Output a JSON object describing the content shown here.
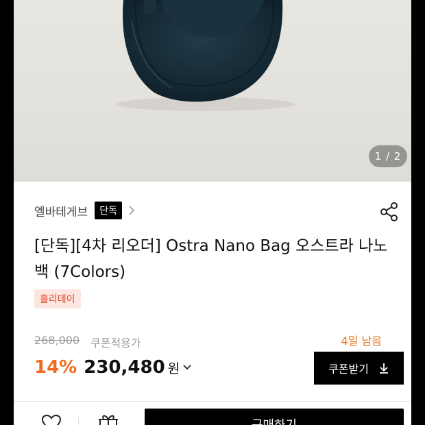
{
  "hero": {
    "pager": "1 / 2"
  },
  "brand": {
    "name": "엘바테게브",
    "badge": "단독"
  },
  "product": {
    "title": "[단독][4차 리오더] Ostra Nano Bag 오스트라 나노 백 (7Colors)",
    "tag": "홀리데이"
  },
  "pricing": {
    "original": "268,000",
    "coupon_note": "쿠폰적용가",
    "days_left": "4일 남음",
    "discount": "14%",
    "price": "230,480",
    "currency": "원"
  },
  "actions": {
    "coupon_button": "쿠폰받기",
    "buy_button": "구매하기"
  },
  "icons": {
    "share": "share-icon",
    "chevron": "chevron-right-icon",
    "heart": "heart-icon",
    "gift": "gift-icon",
    "download": "download-icon",
    "caret": "chevron-down-icon"
  },
  "colors": {
    "accent": "#f26a22",
    "tag_bg": "#fce6df",
    "tag_text": "#e04a2a",
    "bag": "#1c3340"
  }
}
